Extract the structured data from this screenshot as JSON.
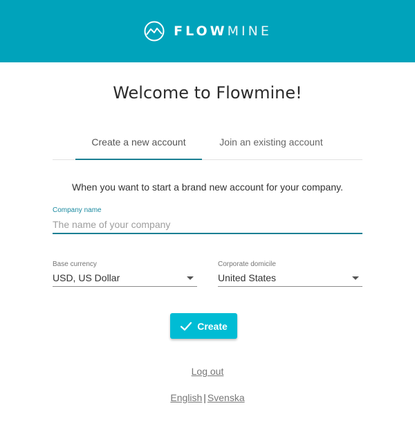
{
  "brand": {
    "logo_bold": "FLOW",
    "logo_light": "MINE",
    "header_color": "#00a3bb"
  },
  "title": "Welcome to Flowmine!",
  "tabs": [
    {
      "label": "Create a new account",
      "active": true
    },
    {
      "label": "Join an existing account",
      "active": false
    }
  ],
  "intro": "When you want to start a brand new account for your company.",
  "company": {
    "label": "Company name",
    "value": "",
    "placeholder": "The name of your company"
  },
  "currency": {
    "label": "Base currency",
    "value": "USD, US Dollar"
  },
  "domicile": {
    "label": "Corporate domicile",
    "value": "United States"
  },
  "create_button": {
    "label": "Create",
    "icon": "check-icon",
    "color": "#00bcd4"
  },
  "logout": "Log out",
  "languages": [
    "English",
    "Svenska"
  ],
  "language_separator": "|",
  "accent_color": "#1b7f93"
}
